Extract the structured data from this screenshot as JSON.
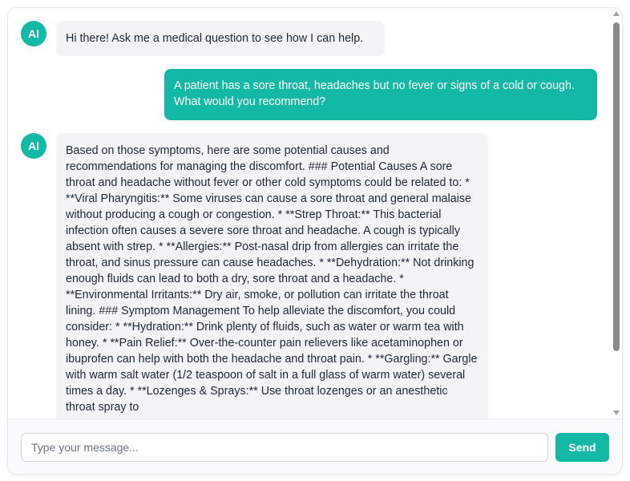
{
  "brand_color": "#14b8a6",
  "messages": [
    {
      "role": "ai",
      "avatar": "AI",
      "text": "Hi there! Ask me a medical question to see how I can help."
    },
    {
      "role": "user",
      "text": "A patient has a sore throat, headaches but no fever or signs of a cold or cough. What would you recommend?"
    },
    {
      "role": "ai",
      "avatar": "AI",
      "text": "Based on those symptoms, here are some potential causes and recommendations for managing the discomfort. ### Potential Causes A sore throat and headache without fever or other cold symptoms could be related to: * **Viral Pharyngitis:** Some viruses can cause a sore throat and general malaise without producing a cough or congestion. * **Strep Throat:** This bacterial infection often causes a severe sore throat and headache. A cough is typically absent with strep. * **Allergies:** Post-nasal drip from allergies can irritate the throat, and sinus pressure can cause headaches. * **Dehydration:** Not drinking enough fluids can lead to both a dry, sore throat and a headache. * **Environmental Irritants:** Dry air, smoke, or pollution can irritate the throat lining. ### Symptom Management To help alleviate the discomfort, you could consider: * **Hydration:** Drink plenty of fluids, such as water or warm tea with honey. * **Pain Relief:** Over-the-counter pain relievers like acetaminophen or ibuprofen can help with both the headache and throat pain. * **Gargling:** Gargle with warm salt water (1/2 teaspoon of salt in a full glass of warm water) several times a day. * **Lozenges & Sprays:** Use throat lozenges or an anesthetic throat spray to"
    }
  ],
  "composer": {
    "placeholder": "Type your message...",
    "value": "",
    "send_label": "Send"
  }
}
